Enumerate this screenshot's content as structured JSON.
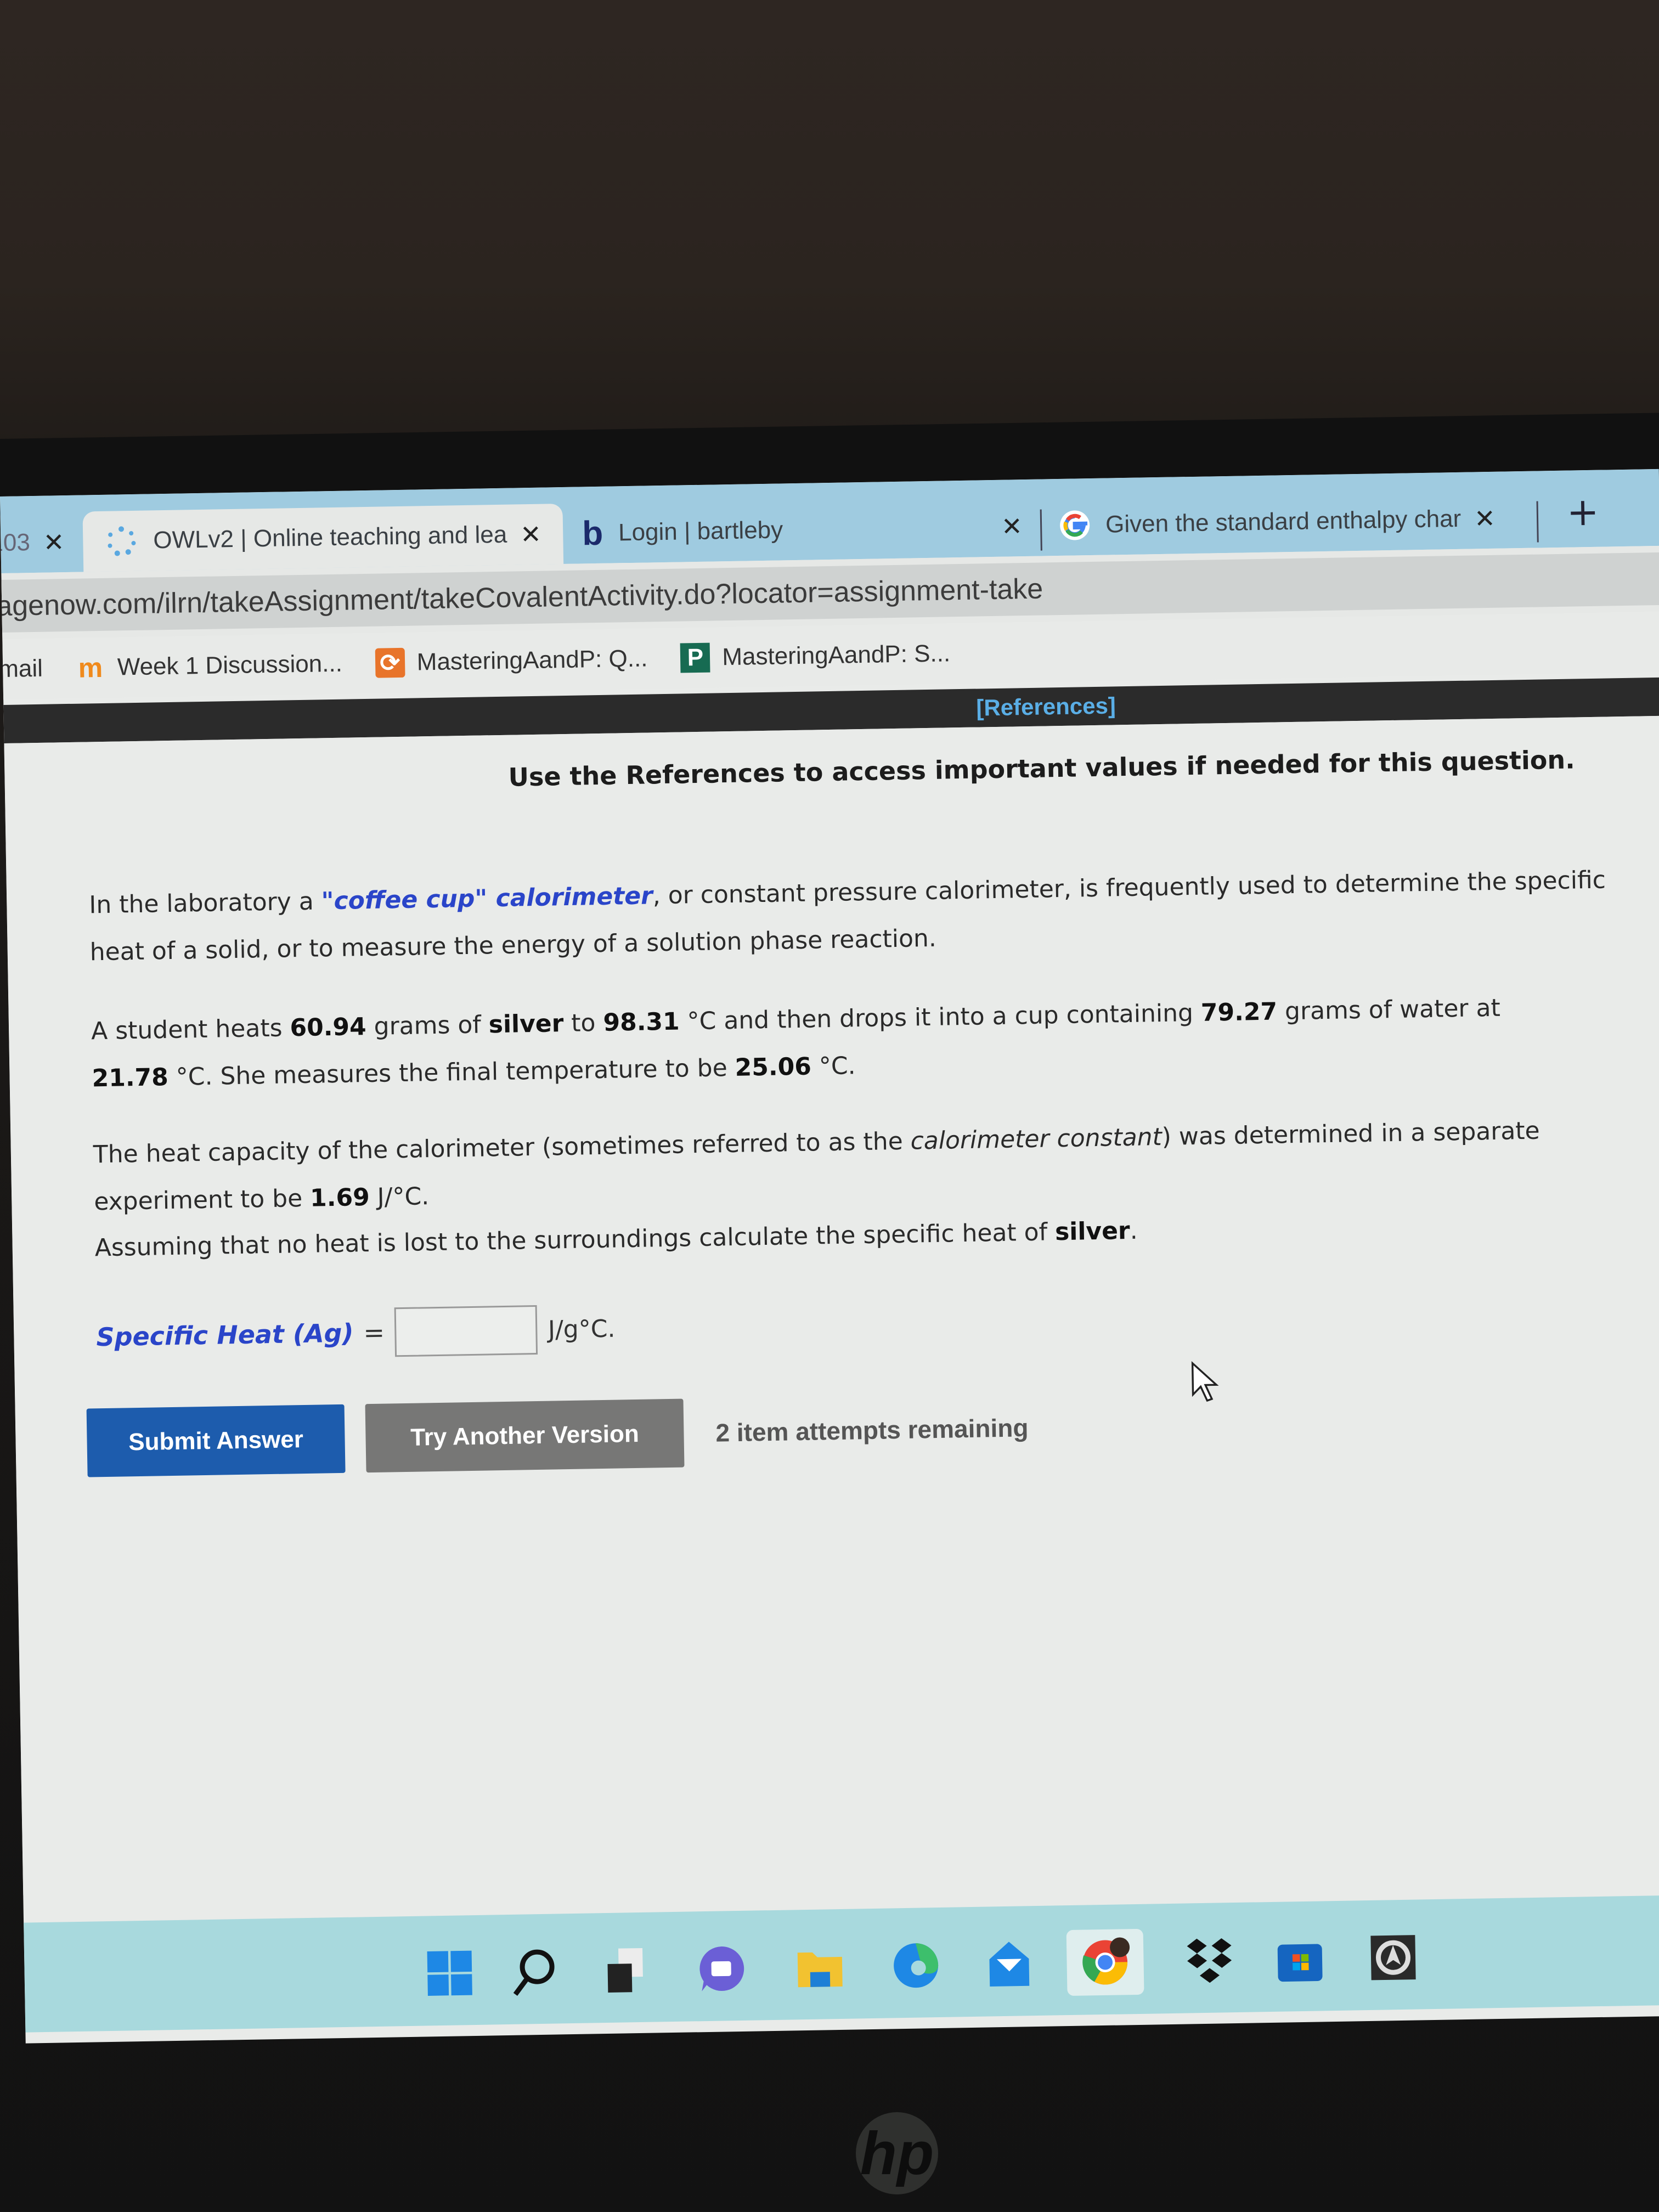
{
  "browser": {
    "tabs": [
      {
        "title": "103",
        "favicon": "partial-tab-icon",
        "active": false
      },
      {
        "title": "OWLv2 | Online teaching and lea",
        "favicon": "owl-spinner-icon",
        "active": true
      },
      {
        "title": "Login | bartleby",
        "favicon": "bartleby-b-icon",
        "active": false
      },
      {
        "title": "Given the standard enthalpy char",
        "favicon": "google-g-icon",
        "active": false
      }
    ],
    "close_glyph": "✕",
    "new_tab_glyph": "+",
    "address": "agenow.com/ilrn/takeAssignment/takeCovalentActivity.do?locator=assignment-take",
    "bookmarks": [
      {
        "label": "mail",
        "icon": "mail-icon"
      },
      {
        "label": "Week 1 Discussion...",
        "icon": "moodle-m-icon",
        "icon_text": "m"
      },
      {
        "label": "MasteringAandP: Q...",
        "icon": "mastering-orange-icon",
        "icon_text": "⟳"
      },
      {
        "label": "MasteringAandP: S...",
        "icon": "pearson-p-icon",
        "icon_text": "P"
      }
    ]
  },
  "page": {
    "references_link": "[References]",
    "use_note": "Use the References to access important values if needed for this question.",
    "para1": {
      "pre": "In the laboratory a ",
      "link": "\"coffee cup\" calorimeter",
      "post_line1": ", or constant pressure calorimeter, is frequently used to determine the specific",
      "line2": "heat of a solid, or to measure the energy of a solution phase reaction."
    },
    "para2": {
      "t1": "A student heats ",
      "mass_silver": "60.94",
      "t2": " grams of ",
      "metal": "silver",
      "t3": " to ",
      "temp_metal": "98.31",
      "t4": " °C and then drops it into a cup containing ",
      "mass_water": "79.27",
      "t5": " grams of water at",
      "temp_water": "21.78",
      "t6": " °C. She measures the final temperature to be ",
      "temp_final": "25.06",
      "t7": " °C."
    },
    "para3": {
      "t1": "The heat capacity of the calorimeter (sometimes referred to as the ",
      "italic": "calorimeter constant",
      "t2": ") was determined in a separate",
      "t3": "experiment to be ",
      "cal_constant": "1.69",
      "t4": " J/°C."
    },
    "para4": {
      "t1": "Assuming that no heat is lost to the surroundings calculate the specific heat of ",
      "metal": "silver",
      "t2": "."
    },
    "answer": {
      "label": "Specific Heat (Ag)",
      "equals": "=",
      "value": "",
      "unit": "J/g°C."
    },
    "buttons": {
      "submit": "Submit Answer",
      "try_another": "Try Another Version"
    },
    "attempts": "2 item attempts remaining"
  },
  "taskbar": {
    "icons": [
      "windows-start-icon",
      "search-icon",
      "task-view-icon",
      "teams-chat-icon",
      "file-explorer-icon",
      "edge-icon",
      "mail-app-icon",
      "chrome-icon",
      "dropbox-icon",
      "microsoft-store-icon",
      "app-shield-icon"
    ],
    "active": "chrome-icon"
  },
  "device": {
    "brand": "hp"
  }
}
